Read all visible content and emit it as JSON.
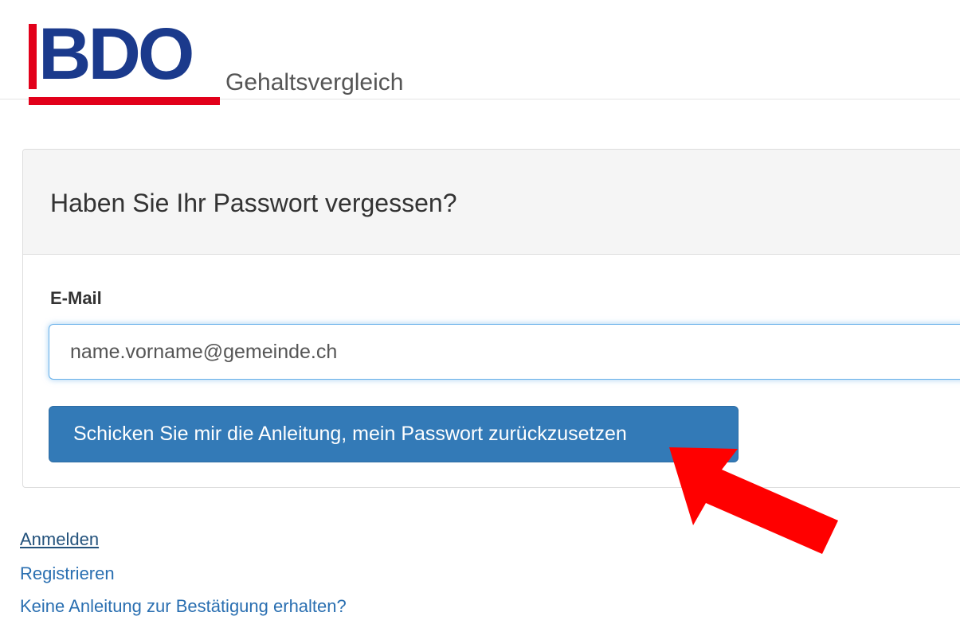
{
  "header": {
    "logo_text": "BDO",
    "subtitle": "Gehaltsvergleich"
  },
  "panel": {
    "title": "Haben Sie Ihr Passwort vergessen?",
    "email_label": "E-Mail",
    "email_value": "name.vorname@gemeinde.ch",
    "submit_label": "Schicken Sie mir die Anleitung, mein Passwort zurückzusetzen"
  },
  "links": {
    "login": "Anmelden",
    "register": "Registrieren",
    "resend": "Keine Anleitung zur Bestätigung erhalten?"
  },
  "colors": {
    "brand_red": "#e2001a",
    "brand_blue": "#1b3a8c",
    "button_blue": "#337ab7",
    "link_blue": "#2a6fb1",
    "annotation_red": "#ff0000"
  },
  "icons": {
    "annotation": "red-arrow-icon"
  }
}
